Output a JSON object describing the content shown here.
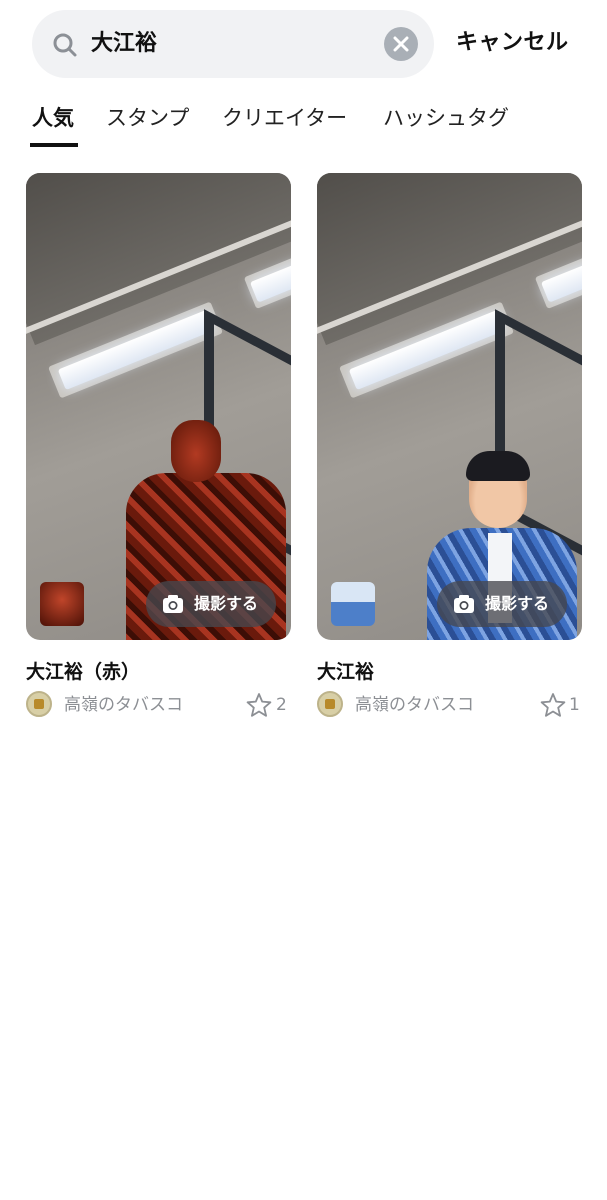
{
  "search": {
    "query": "大江裕",
    "cancel_label": "キャンセル"
  },
  "tabs": [
    {
      "label": "人気",
      "active": true
    },
    {
      "label": "スタンプ",
      "active": false
    },
    {
      "label": "クリエイター",
      "active": false
    },
    {
      "label": "ハッシュタグ",
      "active": false
    }
  ],
  "results": [
    {
      "title": "大江裕（赤）",
      "shoot_label": "撮影する",
      "creator": "高嶺のタバスコ",
      "likes": "2"
    },
    {
      "title": "大江裕",
      "shoot_label": "撮影する",
      "creator": "高嶺のタバスコ",
      "likes": "1"
    }
  ],
  "colors": {
    "search_bg": "#f1f2f4",
    "accent_text": "#111111",
    "muted_text": "#8c8f94"
  },
  "icons": {
    "search": "search-icon",
    "clear": "clear-icon",
    "camera": "camera-icon",
    "star": "star-icon"
  }
}
